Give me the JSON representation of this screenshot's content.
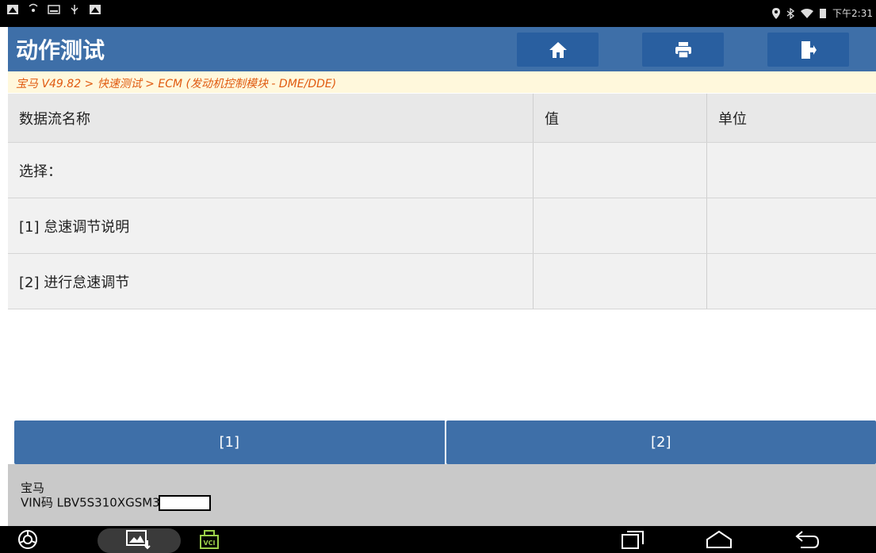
{
  "status_bar": {
    "time": "下午2:31",
    "left_icons": [
      "notification-icon",
      "hotspot-icon",
      "image-icon",
      "usb-icon",
      "notification-icon"
    ],
    "right_icons": [
      "location-icon",
      "bluetooth-icon",
      "wifi-icon",
      "battery-icon"
    ]
  },
  "header": {
    "title": "动作测试",
    "buttons": [
      "home-icon",
      "print-icon",
      "exit-icon"
    ]
  },
  "breadcrumb": "宝马 V49.82 > 快速测试 > ECM (发动机控制模块 - DME/DDE)",
  "table": {
    "columns": [
      "数据流名称",
      "值",
      "单位"
    ],
    "rows": [
      [
        "选择：",
        "",
        ""
      ],
      [
        "[1] 怠速调节说明",
        "",
        ""
      ],
      [
        "[2] 进行怠速调节",
        "",
        ""
      ]
    ]
  },
  "actions": [
    "[1]",
    "[2]"
  ],
  "footer": {
    "make": "宝马",
    "vin": "VIN码 LBV5S310XGSM3"
  },
  "nav": {
    "icons": [
      "browser-icon",
      "gallery-icon",
      "vci-icon",
      "recent-apps-icon",
      "home-nav-icon",
      "back-icon"
    ],
    "vci_label": "VCI"
  },
  "colors": {
    "header_blue": "#3e6fa8",
    "button_blue": "#295fa0",
    "breadcrumb_text": "#e05a10",
    "breadcrumb_bg": "#fff8dc"
  }
}
